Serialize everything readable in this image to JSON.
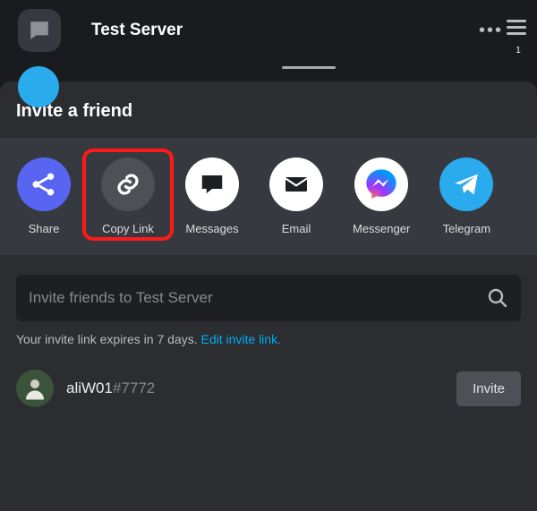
{
  "header": {
    "server_name": "Test Server",
    "badge_count": "1"
  },
  "sheet": {
    "title": "Invite a friend"
  },
  "share_options": {
    "share": "Share",
    "copy_link": "Copy Link",
    "messages": "Messages",
    "email": "Email",
    "messenger": "Messenger",
    "telegram": "Telegram"
  },
  "search": {
    "placeholder": "Invite friends to Test Server"
  },
  "expire": {
    "text": "Your invite link expires in 7 days. ",
    "link": "Edit invite link."
  },
  "user": {
    "name": "aliW01",
    "tag": "#7772",
    "invite_label": "Invite"
  }
}
